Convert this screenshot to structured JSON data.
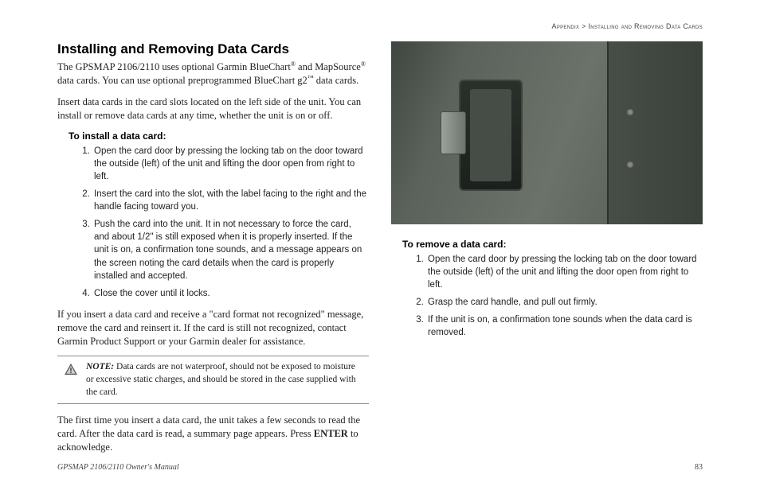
{
  "breadcrumb": {
    "left": "Appendix",
    "sep": " > ",
    "right": "Installing and Removing Data Cards"
  },
  "left": {
    "h1": "Installing and Removing Data Cards",
    "p1a": "The GPSMAP 2106/2110 uses optional Garmin BlueChart",
    "p1b": " and MapSource",
    "p1c": " data cards. You can use optional preprogrammed BlueChart g2",
    "p1d": " data cards.",
    "reg": "®",
    "tm": "™",
    "p2": "Insert data cards in the card slots located on the left side of the unit. You can install or remove data cards at any time, whether the unit is on or off.",
    "install_head": "To install a data card:",
    "install": [
      "Open the card door by pressing the locking tab on the door toward the outside (left) of the unit and lifting the door open from right to left.",
      "Insert the card into the slot, with the label facing to the right and the handle facing toward you.",
      "Push the card into the unit. It in not necessary to force the card, and about 1/2\" is still exposed when it is properly inserted. If the unit is on, a confirmation tone sounds, and a message appears on the screen noting the card details when the card is properly installed and accepted.",
      "Close the cover until it locks."
    ],
    "p3": "If you insert a data card and receive a \"card format not recognized\" message, remove the card and reinsert it. If the card is still not recognized, contact Garmin Product Support or your Garmin dealer for assistance.",
    "note_label": "NOTE:",
    "note": " Data cards are not waterproof, should not be exposed to moisture or excessive static charges, and should be stored in the case supplied with the card.",
    "p4a": "The first time you insert a data card, the unit takes a few seconds to read the card. After the data card is read, a summary page appears. Press ",
    "p4b": "ENTER",
    "p4c": " to acknowledge."
  },
  "right": {
    "remove_head": "To remove a data card:",
    "remove": [
      "Open the card door by pressing the locking tab on the door toward the outside (left) of the unit and lifting the door open from right to left.",
      "Grasp the card handle, and pull out firmly.",
      "If the unit is on, a confirmation tone sounds when the data card is removed."
    ]
  },
  "footer": {
    "left": "GPSMAP 2106/2110 Owner's Manual",
    "right": "83"
  }
}
